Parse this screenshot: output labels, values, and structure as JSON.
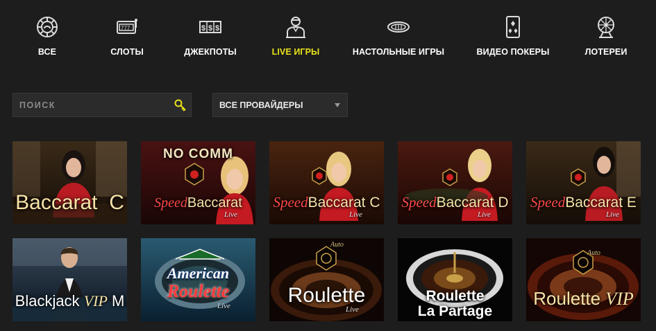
{
  "nav": {
    "items": [
      {
        "label": "ВСЕ",
        "icon": "all-games-icon",
        "active": false
      },
      {
        "label": "СЛОТЫ",
        "icon": "slot-machine-icon",
        "active": false
      },
      {
        "label": "ДЖЕКПОТЫ",
        "icon": "jackpot-icon",
        "active": false
      },
      {
        "label": "LIVE ИГРЫ",
        "icon": "live-dealer-icon",
        "active": true
      },
      {
        "label": "НАСТОЛЬНЫЕ ИГРЫ",
        "icon": "table-games-icon",
        "active": false
      },
      {
        "label": "ВИДЕО ПОКЕРЫ",
        "icon": "video-poker-icon",
        "active": false
      },
      {
        "label": "ЛОТЕРЕИ",
        "icon": "lottery-icon",
        "active": false
      }
    ]
  },
  "filters": {
    "search_placeholder": "ПОИСК",
    "provider_selected": "ВСЕ ПРОВАЙДЕРЫ"
  },
  "colors": {
    "active": "#e9e21a",
    "background": "#1d1d1d",
    "accent_red": "#ff4a4a"
  },
  "games": {
    "row1": [
      {
        "title": "Baccarat",
        "suffix": "C"
      },
      {
        "top": "NO COMM",
        "speed": "Speed",
        "title": "Baccarat",
        "suffix": "",
        "live": "Live"
      },
      {
        "speed": "Speed",
        "title": "Baccarat",
        "suffix": "C",
        "live": "Live"
      },
      {
        "speed": "Speed",
        "title": "Baccarat",
        "suffix": "D",
        "live": "Live"
      },
      {
        "speed": "Speed",
        "title": "Baccarat",
        "suffix": "E",
        "live": "Live"
      }
    ],
    "row2": [
      {
        "title": "Blackjack",
        "vip": "VIP",
        "suffix": "M"
      },
      {
        "line1": "American",
        "line2": "Roulette",
        "live": "Live"
      },
      {
        "badge": "Auto",
        "title": "Roulette",
        "live": "Live"
      },
      {
        "line1": "Roulette",
        "line2": "La Partage"
      },
      {
        "badge": "Auto",
        "title": "Roulette",
        "vip": "VIP"
      }
    ]
  }
}
